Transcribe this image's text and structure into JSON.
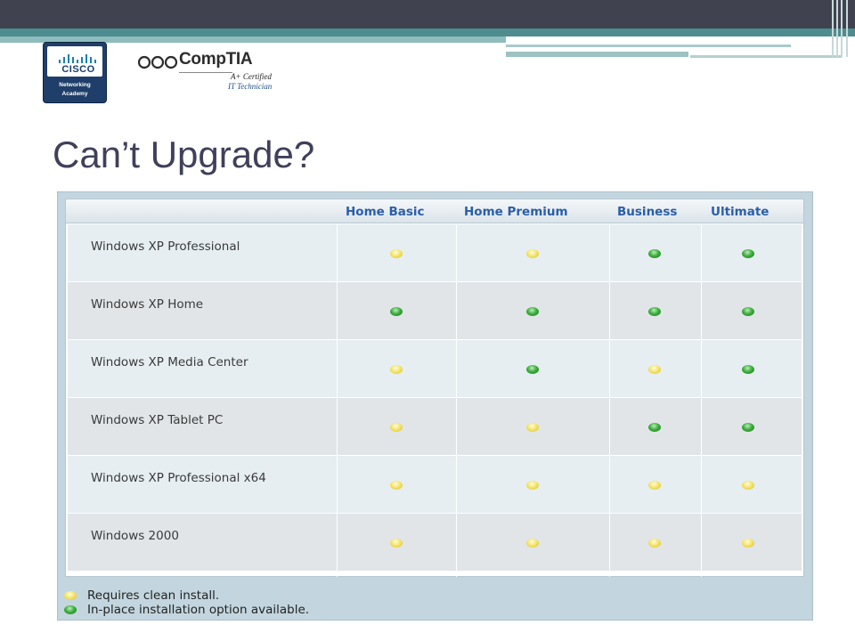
{
  "slide": {
    "title": "Can’t Upgrade?"
  },
  "logos": {
    "cisco": {
      "word": "CISCO",
      "line1": "Networking",
      "line2": "Academy"
    },
    "comptia": {
      "word": "CompTIA",
      "cert1": "A+ Certified",
      "cert2": "IT Technician"
    }
  },
  "table": {
    "columns": [
      "Home Basic",
      "Home Premium",
      "Business",
      "Ultimate"
    ],
    "rows": [
      {
        "label": "Windows XP Professional",
        "status": [
          "clean",
          "clean",
          "inplace",
          "inplace"
        ]
      },
      {
        "label": "Windows XP Home",
        "status": [
          "inplace",
          "inplace",
          "inplace",
          "inplace"
        ]
      },
      {
        "label": "Windows XP Media Center",
        "status": [
          "clean",
          "inplace",
          "clean",
          "inplace"
        ]
      },
      {
        "label": "Windows XP Tablet PC",
        "status": [
          "clean",
          "clean",
          "inplace",
          "inplace"
        ]
      },
      {
        "label": "Windows XP Professional x64",
        "status": [
          "clean",
          "clean",
          "clean",
          "clean"
        ]
      },
      {
        "label": "Windows 2000",
        "status": [
          "clean",
          "clean",
          "clean",
          "clean"
        ]
      }
    ]
  },
  "legend": {
    "clean": "Requires clean install.",
    "inplace": "In-place installation option available."
  },
  "colors": {
    "title": "#40405a",
    "header_text": "#2b5ea8",
    "clean_dot": "#f5e56a",
    "inplace_dot": "#3fae3f"
  }
}
